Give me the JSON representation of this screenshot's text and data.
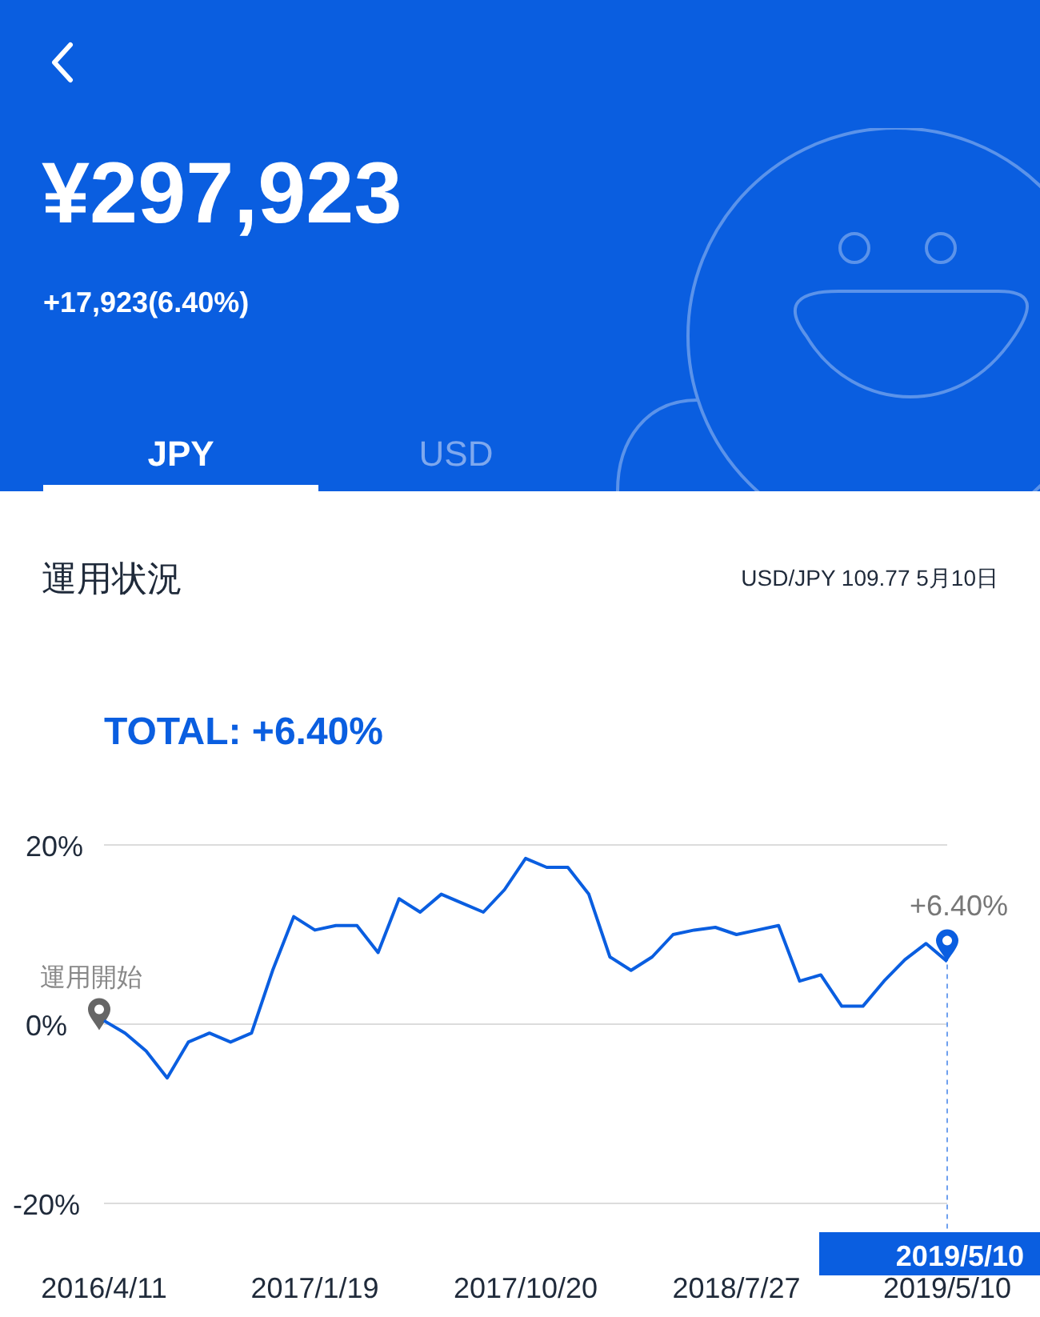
{
  "header": {
    "amount": "¥297,923",
    "change": "+17,923(6.40%)"
  },
  "tabs": [
    {
      "label": "JPY",
      "selected": true
    },
    {
      "label": "USD",
      "selected": false
    }
  ],
  "section": {
    "title": "運用状況",
    "rate": "USD/JPY 109.77 5月10日"
  },
  "chart_data": {
    "type": "line",
    "title": "TOTAL: +6.40%",
    "ylim": [
      -20,
      20
    ],
    "yticks": [
      {
        "value": 20,
        "label": "20%"
      },
      {
        "value": 0,
        "label": "0%"
      },
      {
        "value": -20,
        "label": "-20%"
      }
    ],
    "categories": [
      "2016/4/11",
      null,
      null,
      null,
      null,
      null,
      null,
      null,
      null,
      null,
      "2017/1/19",
      null,
      null,
      null,
      null,
      null,
      null,
      null,
      null,
      null,
      "2017/10/20",
      null,
      null,
      null,
      null,
      null,
      null,
      null,
      null,
      null,
      "2018/7/27",
      null,
      null,
      null,
      null,
      null,
      null,
      null,
      null,
      null,
      "2019/5/10"
    ],
    "series": [
      {
        "color": "#0a5ee0",
        "values": [
          0.4,
          -1,
          -3,
          -6,
          -2,
          -1,
          -2,
          -1,
          6,
          12,
          10.5,
          11,
          11,
          8,
          14,
          12.5,
          14.5,
          13.5,
          12.5,
          15,
          18.5,
          17.5,
          17.5,
          14.5,
          7.5,
          6,
          7.5,
          10,
          10.5,
          10.8,
          10,
          10.5,
          11,
          4.8,
          5.5,
          2,
          2,
          4.8,
          7.2,
          9,
          7
        ]
      }
    ],
    "annotations": [
      {
        "text": "運用開始"
      },
      {
        "text": "+6.40%"
      },
      "2019/5/10"
    ]
  }
}
